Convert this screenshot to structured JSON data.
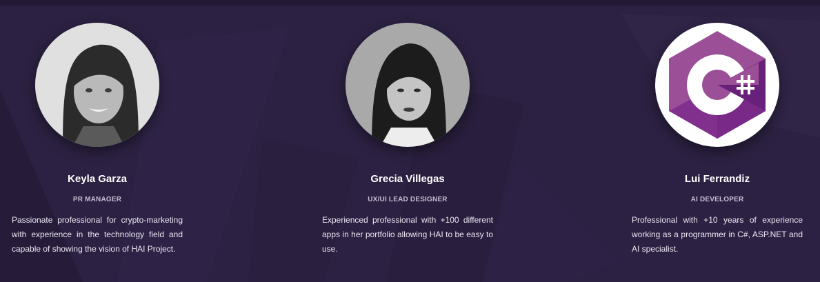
{
  "team": {
    "members": [
      {
        "name": "Keyla Garza",
        "role": "PR MANAGER",
        "bio": "Passionate professional for crypto-marketing with experience in the technology field and capable of showing the vision of HAI Project."
      },
      {
        "name": "Grecia Villegas",
        "role": "UX/UI LEAD DESIGNER",
        "bio": "Experienced professional with +100 different apps in her portfolio allowing HAI to be easy to use."
      },
      {
        "name": "Lui Ferrandiz",
        "role": "AI DEVELOPER",
        "bio": "Professional with +10 years of experience working as a programmer in C#, ASP.NET and AI specialist."
      }
    ]
  },
  "icons": {
    "member_3_avatar": "csharp-logo-icon"
  },
  "colors": {
    "background": "#2c2142",
    "name_text": "#ffffff",
    "role_text": "#c6bfd3",
    "bio_text": "#ece8f3",
    "csharp_purple": "#9b4f96"
  }
}
